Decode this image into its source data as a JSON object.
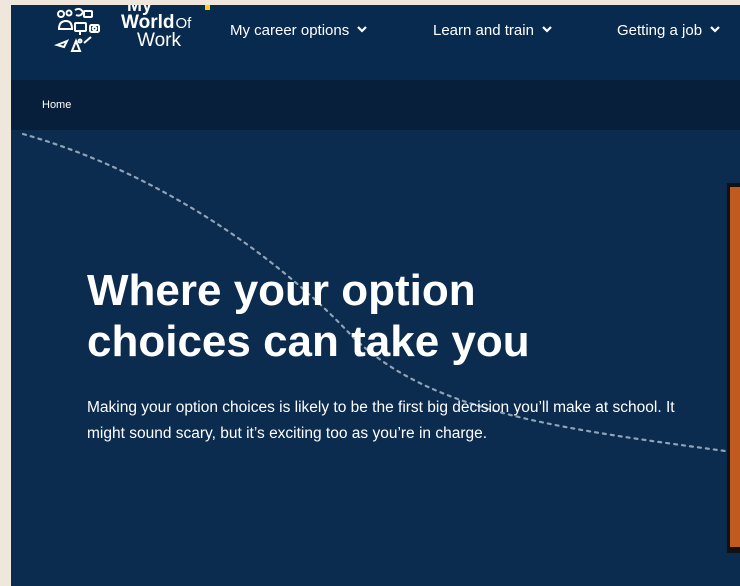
{
  "logo": {
    "line1": "My",
    "line2": "World",
    "of": "Of",
    "line3": "Work"
  },
  "nav": {
    "items": [
      {
        "label": "My career options"
      },
      {
        "label": "Learn and train"
      },
      {
        "label": "Getting a job"
      }
    ]
  },
  "breadcrumb": {
    "home": "Home"
  },
  "hero": {
    "title": "Where your option choices can take you",
    "body": "Making your option choices is likely to be the first big decision you’ll make at school. It might sound scary, but it’s exciting too as you’re in charge."
  },
  "colors": {
    "navy": "#0b2b4f",
    "dark_band": "#071f3a",
    "accent_orange": "#c05a1e",
    "accent_yellow": "#ffd200"
  }
}
